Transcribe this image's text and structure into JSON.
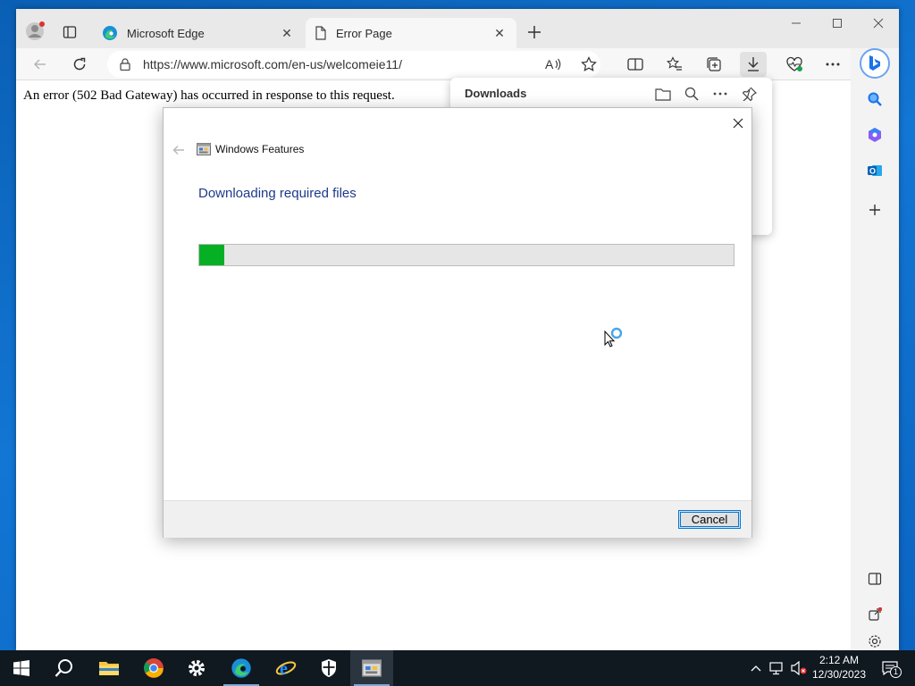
{
  "browser": {
    "tabs": [
      {
        "label": "Microsoft Edge",
        "icon": "edge-icon"
      },
      {
        "label": "Error Page",
        "icon": "page-icon"
      }
    ],
    "address": {
      "url": "https://www.microsoft.com/en-us/welcomeie11/"
    }
  },
  "page": {
    "error_text": "An error (502 Bad Gateway) has occurred in response to this request."
  },
  "downloads": {
    "title": "Downloads"
  },
  "dialog": {
    "app_title": "Windows Features",
    "heading": "Downloading required files",
    "progress_fraction": 0.047,
    "cancel_label": "Cancel",
    "progress_color": "#06b025"
  },
  "taskbar": {
    "apps": [
      "start",
      "search",
      "file-explorer",
      "chrome",
      "settings",
      "edge",
      "internet-explorer",
      "windows-security",
      "windows-features"
    ],
    "time": "2:12 AM",
    "date": "12/30/2023",
    "notification_count": "1"
  },
  "colors": {
    "accent": "#0078d7",
    "desktop": "#0a5fb4",
    "taskbar": "#101820"
  }
}
